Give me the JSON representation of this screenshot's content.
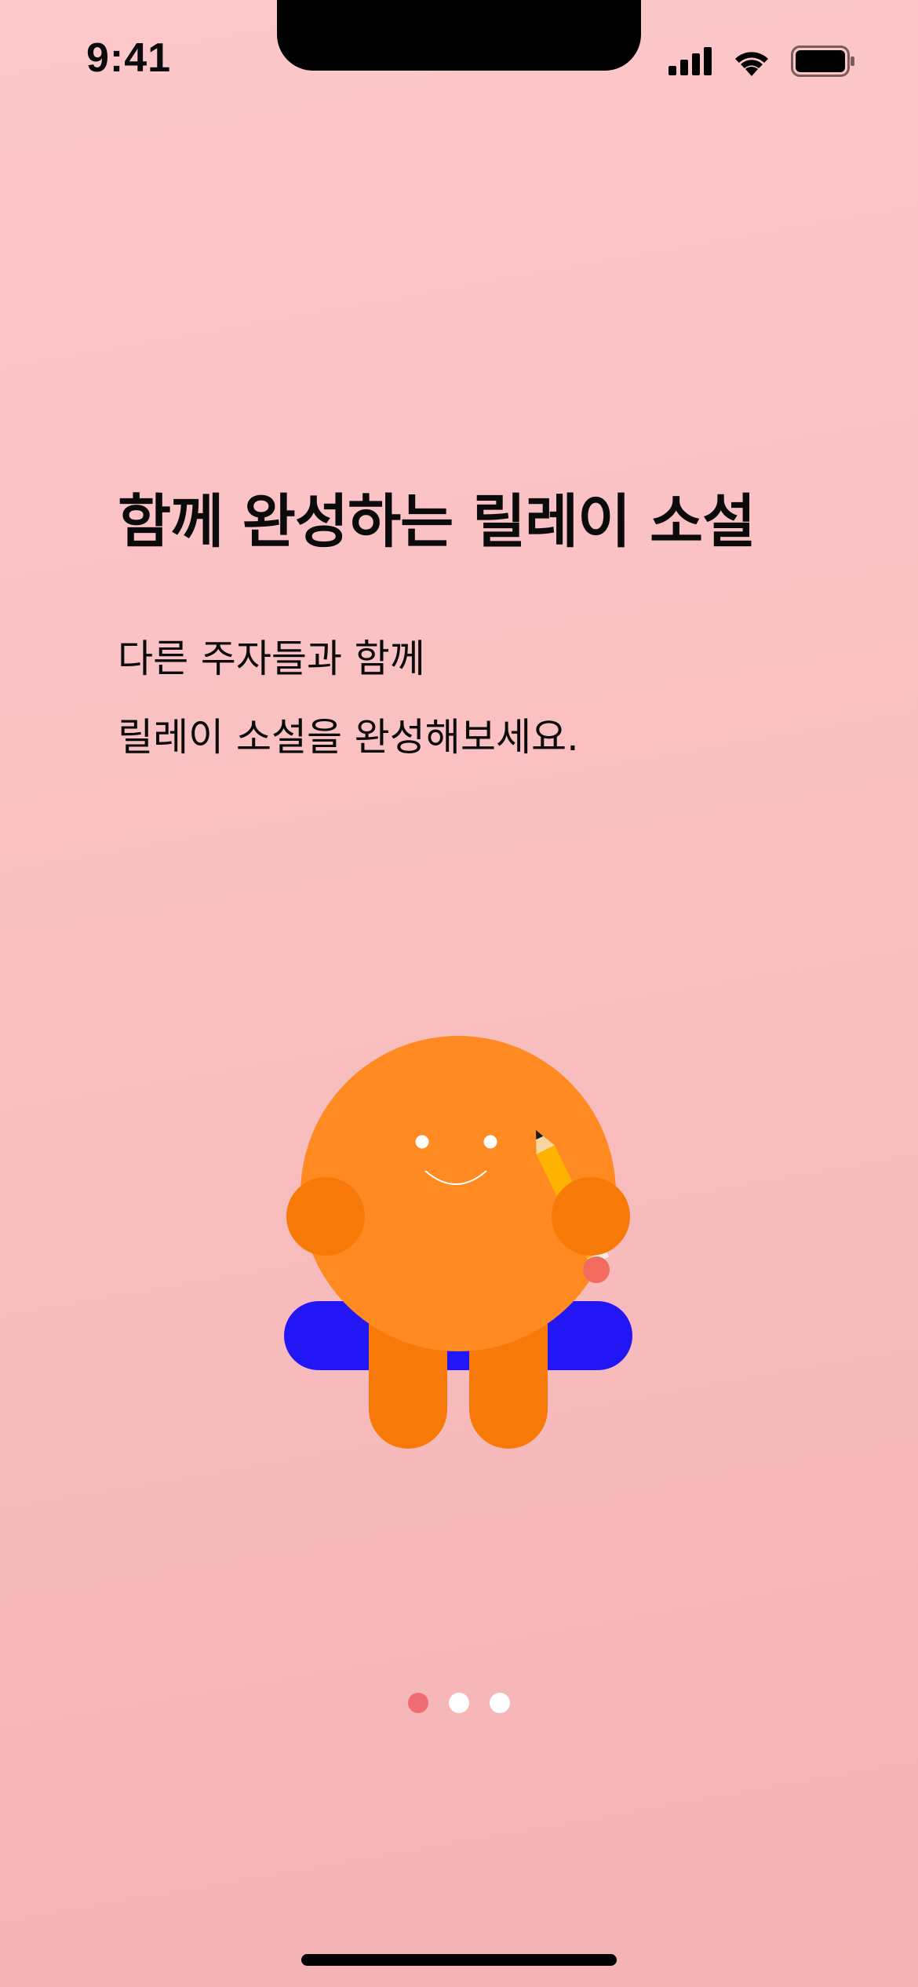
{
  "status_bar": {
    "time": "9:41",
    "icons": [
      "cellular-signal-icon",
      "wifi-icon",
      "battery-icon"
    ]
  },
  "onboarding": {
    "title": "함께 완성하는 릴레이 소설",
    "description_lines": [
      "다른 주자들과 함께",
      "릴레이 소설을 완성해보세요."
    ],
    "illustration": "orange-character-with-pencil",
    "page_indicator": {
      "total": 3,
      "current": 1
    }
  },
  "colors": {
    "background_top": "#fdc8ca",
    "background_bottom": "#f4b3b4",
    "character_body": "#ff8a22",
    "character_limbs": "#f77907",
    "character_mat": "#2316f5",
    "pencil": "#ffb200",
    "indicator_active": "#ee6c72",
    "indicator_inactive": "#ffffff"
  }
}
